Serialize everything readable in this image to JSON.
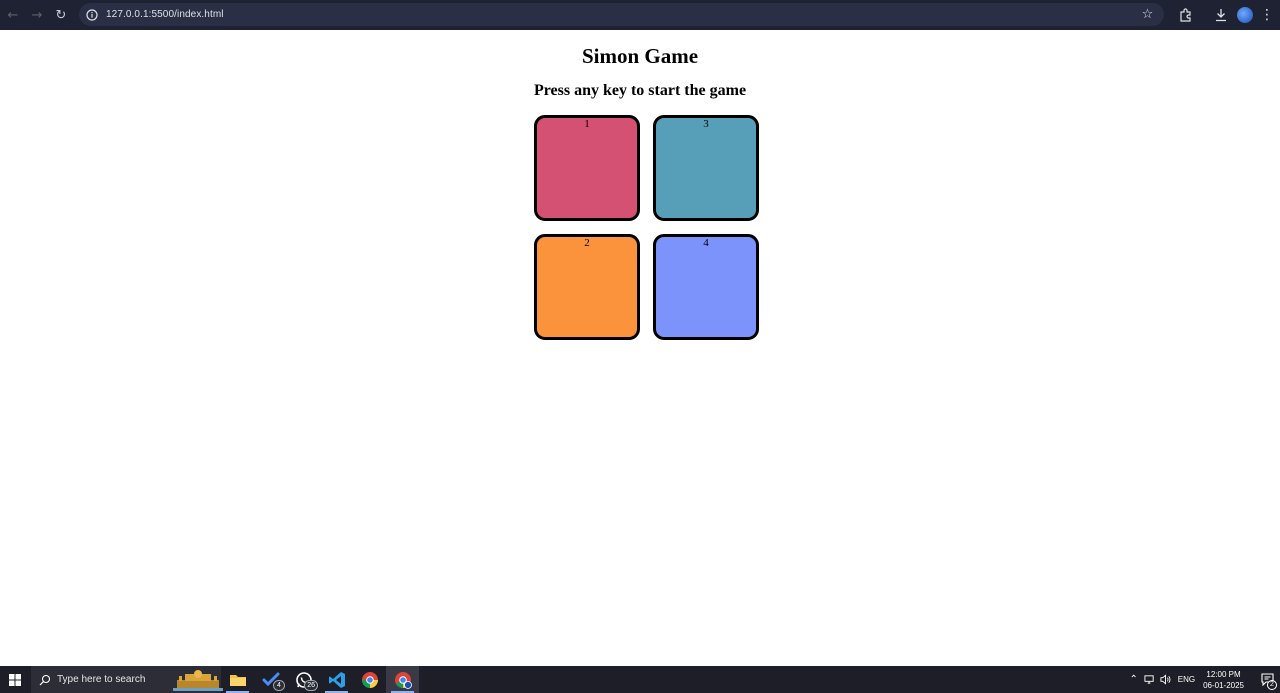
{
  "browser": {
    "url": "127.0.0.1:5500/index.html"
  },
  "page": {
    "title": "Simon Game",
    "subtitle": "Press any key to start the game",
    "boxes": [
      {
        "label": "1",
        "color": "#d45174"
      },
      {
        "label": "3",
        "color": "#579fb9"
      },
      {
        "label": "2",
        "color": "#fb923c"
      },
      {
        "label": "4",
        "color": "#7b93fa"
      }
    ]
  },
  "taskbar": {
    "search_placeholder": "Type here to search",
    "todo_badge": "4",
    "whatsapp_badge": "26",
    "language": "ENG",
    "time": "12:00 PM",
    "date": "06-01-2025",
    "notification_count": "2"
  },
  "icons": {
    "back": "arrow-left-icon",
    "forward": "arrow-right-icon",
    "reload": "reload-icon",
    "site_info": "info-icon",
    "bookmark": "star-icon",
    "extensions": "puzzle-icon",
    "download": "download-icon",
    "profile": "profile-icon",
    "menu": "kebab-menu-icon"
  }
}
